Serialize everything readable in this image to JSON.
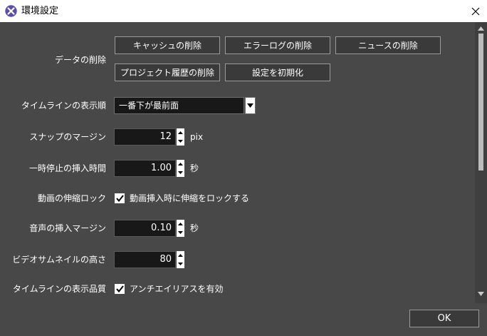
{
  "window": {
    "title": "環境設定"
  },
  "data_section": {
    "label": "データの削除",
    "buttons": [
      "キャッシュの削除",
      "エラーログの削除",
      "ニュースの削除",
      "プロジェクト履歴の削除",
      "設定を初期化"
    ]
  },
  "timeline_order": {
    "label": "タイムラインの表示順",
    "value": "一番下が最前面"
  },
  "snap_margin": {
    "label": "スナップのマージン",
    "value": "12",
    "unit": "pix"
  },
  "pause_insert": {
    "label": "一時停止の挿入時間",
    "value": "1.00",
    "unit": "秒"
  },
  "video_lock": {
    "label": "動画の伸縮ロック",
    "checked": true,
    "check_label": "動画挿入時に伸縮をロックする"
  },
  "audio_insert": {
    "label": "音声の挿入マージン",
    "value": "0.10",
    "unit": "秒"
  },
  "thumbnail_height": {
    "label": "ビデオサムネイルの高さ",
    "value": "80"
  },
  "timeline_quality": {
    "label": "タイムラインの表示品質",
    "checked": true,
    "check_label": "アンチエイリアスを有効"
  },
  "footer": {
    "ok_label": "OK"
  },
  "icons": [
    "app-icon",
    "close-icon",
    "chevron-down-icon",
    "spin-up-icon",
    "spin-down-icon",
    "checkmark-icon",
    "scroll-up-icon",
    "scroll-down-icon"
  ],
  "colors": {
    "background": "#484848",
    "field": "#181818",
    "text": "#ffffff",
    "button_border": "#9a9a9a",
    "titlebar": "#ffffff"
  }
}
